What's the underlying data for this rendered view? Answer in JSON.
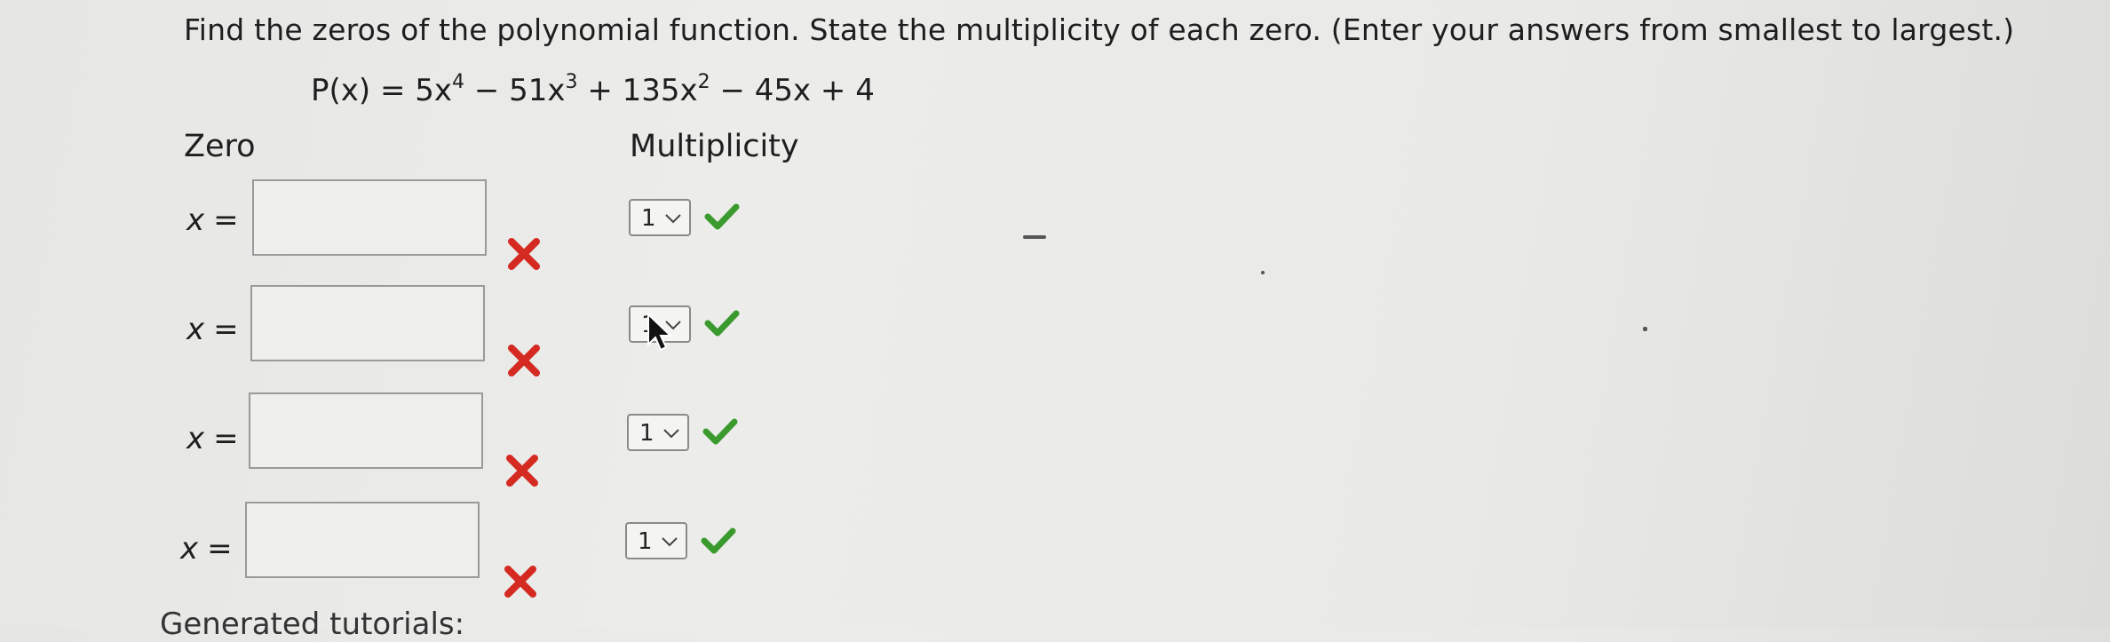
{
  "question": {
    "text": "Find the zeros of the polynomial function. State the multiplicity of each zero. (Enter your answers from smallest to largest.)"
  },
  "equation": {
    "lhs": "P(x) = 5x",
    "exp1": "4",
    "t2": " − 51x",
    "exp2": "3",
    "t3": " + 135x",
    "exp3": "2",
    "t4": " − 45x + 4"
  },
  "headers": {
    "zero": "Zero",
    "multiplicity": "Multiplicity"
  },
  "rows": [
    {
      "label": "x",
      "eq": "=",
      "value": "",
      "multiplicity": "1",
      "zero_status": "incorrect",
      "mult_status": "correct"
    },
    {
      "label": "x",
      "eq": "=",
      "value": "",
      "multiplicity": "1",
      "zero_status": "incorrect",
      "mult_status": "correct"
    },
    {
      "label": "x",
      "eq": "=",
      "value": "",
      "multiplicity": "1",
      "zero_status": "incorrect",
      "mult_status": "correct"
    },
    {
      "label": "x",
      "eq": "=",
      "value": "",
      "multiplicity": "1",
      "zero_status": "incorrect",
      "mult_status": "correct"
    }
  ],
  "footer": {
    "partial_text": "Generated tutorials:"
  },
  "colors": {
    "incorrect": "#d42a22",
    "correct": "#3a9a2e"
  }
}
